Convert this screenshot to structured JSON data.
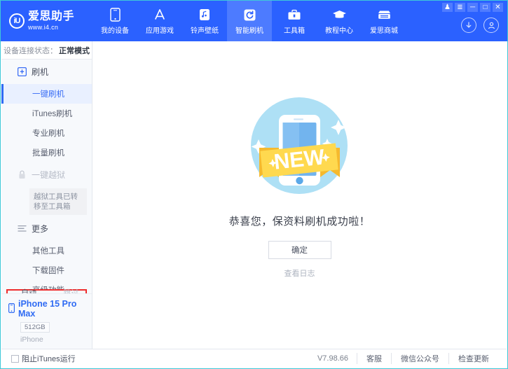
{
  "titlebar": {
    "controls": [
      {
        "name": "skin-icon",
        "glyph": "♟"
      },
      {
        "name": "menu-icon",
        "glyph": "≣"
      },
      {
        "name": "minimize-icon",
        "glyph": "─"
      },
      {
        "name": "maximize-icon",
        "glyph": "□"
      },
      {
        "name": "close-icon",
        "glyph": "✕"
      }
    ],
    "download_icon": "download-icon",
    "account_icon": "account-icon"
  },
  "brand": {
    "mark": "iU",
    "name": "爱思助手",
    "url": "www.i4.cn"
  },
  "nav": {
    "items": [
      {
        "label": "我的设备",
        "icon": "phone-icon",
        "active": false
      },
      {
        "label": "应用游戏",
        "icon": "appstore-icon",
        "active": false
      },
      {
        "label": "铃声壁纸",
        "icon": "music-icon",
        "active": false
      },
      {
        "label": "智能刷机",
        "icon": "refresh-icon",
        "active": true
      },
      {
        "label": "工具箱",
        "icon": "toolbox-icon",
        "active": false
      },
      {
        "label": "教程中心",
        "icon": "graduation-icon",
        "active": false
      },
      {
        "label": "爱思商城",
        "icon": "shop-icon",
        "active": false
      }
    ]
  },
  "sidebar": {
    "status_label": "设备连接状态：",
    "status_value": "正常模式",
    "group_flash": {
      "label": "刷机",
      "icon": "flash-device-icon"
    },
    "flash_items": [
      {
        "label": "一键刷机",
        "selected": true
      },
      {
        "label": "iTunes刷机",
        "selected": false
      },
      {
        "label": "专业刷机",
        "selected": false
      },
      {
        "label": "批量刷机",
        "selected": false
      }
    ],
    "group_jailbreak": {
      "label": "一键越狱",
      "icon": "lock-icon",
      "disabled": true
    },
    "jailbreak_tip": "越狱工具已转移至工具箱",
    "group_more": {
      "label": "更多",
      "icon": "list-icon"
    },
    "more_items": [
      {
        "label": "其他工具"
      },
      {
        "label": "下载固件"
      },
      {
        "label": "高级功能"
      }
    ],
    "options": [
      {
        "label": "自动激活",
        "checked": false,
        "disabled": false
      },
      {
        "label": "跳过向导",
        "checked": false,
        "disabled": true
      }
    ],
    "device": {
      "name": "iPhone 15 Pro Max",
      "capacity": "512GB",
      "type": "iPhone",
      "icon": "phone-small-icon"
    }
  },
  "main": {
    "illustration": "new-phone-badge-illustration",
    "ribbon_text": "NEW",
    "message": "恭喜您，保资料刷机成功啦！",
    "confirm_label": "确定",
    "log_link": "查看日志"
  },
  "statusbar": {
    "block_itunes": "阻止iTunes运行",
    "block_itunes_checked": false,
    "version": "V7.98.66",
    "links": [
      "客服",
      "微信公众号",
      "检查更新"
    ]
  },
  "colors": {
    "header_blue": "#2b61ff",
    "active_tab": "#4d7bff",
    "accent": "#2f6bf3",
    "highlight_red": "#ee2d2d"
  }
}
